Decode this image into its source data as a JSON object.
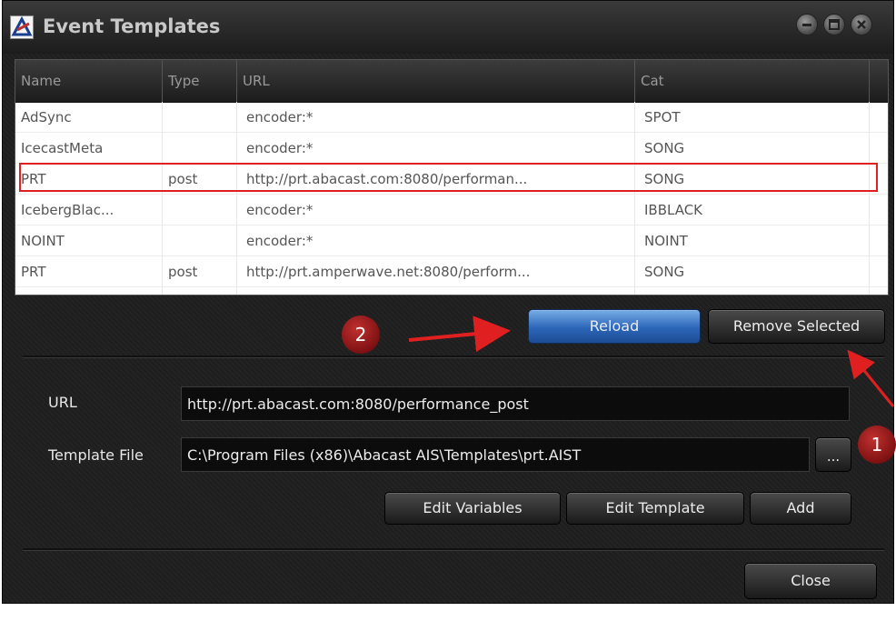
{
  "window": {
    "title": "Event Templates"
  },
  "table": {
    "columns": [
      "Name",
      "Type",
      "URL",
      "Cat"
    ],
    "rows": [
      {
        "name": "AdSync",
        "type": "",
        "url": "encoder:*",
        "cat": "SPOT"
      },
      {
        "name": "IcecastMeta",
        "type": "",
        "url": "encoder:*",
        "cat": "SONG"
      },
      {
        "name": "PRT",
        "type": "post",
        "url": "http://prt.abacast.com:8080/performan...",
        "cat": "SONG"
      },
      {
        "name": "IcebergBlac...",
        "type": "",
        "url": "encoder:*",
        "cat": "IBBLACK"
      },
      {
        "name": "NOINT",
        "type": "",
        "url": "encoder:*",
        "cat": "NOINT"
      },
      {
        "name": "PRT",
        "type": "post",
        "url": "http://prt.amperwave.net:8080/perform...",
        "cat": "SONG"
      }
    ]
  },
  "buttons": {
    "reload": "Reload",
    "remove_selected": "Remove Selected",
    "browse": "...",
    "edit_variables": "Edit Variables",
    "edit_template": "Edit Template",
    "add": "Add",
    "close": "Close"
  },
  "form": {
    "url_label": "URL",
    "url_value": "http://prt.abacast.com:8080/performance_post",
    "template_label": "Template File",
    "template_value": "C:\\Program Files (x86)\\Abacast AIS\\Templates\\prt.AIST"
  },
  "annotations": {
    "badge_1": "1",
    "badge_2": "2",
    "color": "#e02020"
  }
}
